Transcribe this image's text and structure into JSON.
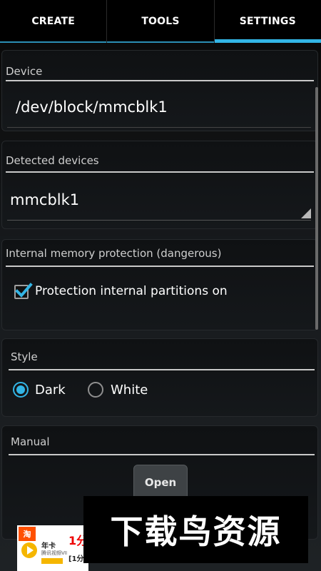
{
  "tabs": [
    {
      "label": "CREATE",
      "active": false
    },
    {
      "label": "TOOLS",
      "active": false
    },
    {
      "label": "SETTINGS",
      "active": true
    }
  ],
  "device": {
    "title": "Device",
    "value": "/dev/block/mmcblk1"
  },
  "detected": {
    "title": "Detected devices",
    "selected": "mmcblk1"
  },
  "protection": {
    "title": "Internal memory protection (dangerous)",
    "checkbox_label": "Protection internal partitions on",
    "checked": true
  },
  "style": {
    "title": "Style",
    "options": [
      {
        "label": "Dark",
        "selected": true
      },
      {
        "label": "White",
        "selected": false
      }
    ]
  },
  "manual": {
    "title": "Manual",
    "button_label": "Open"
  },
  "ad": {
    "logo": "淘",
    "title": "年卡",
    "subtitle": "腾讯视频VIP",
    "strip_top": "1分",
    "strip_bottom": "[1分"
  },
  "watermark": "下载鸟资源",
  "colors": {
    "accent": "#33b5e5",
    "background": "#000000"
  }
}
